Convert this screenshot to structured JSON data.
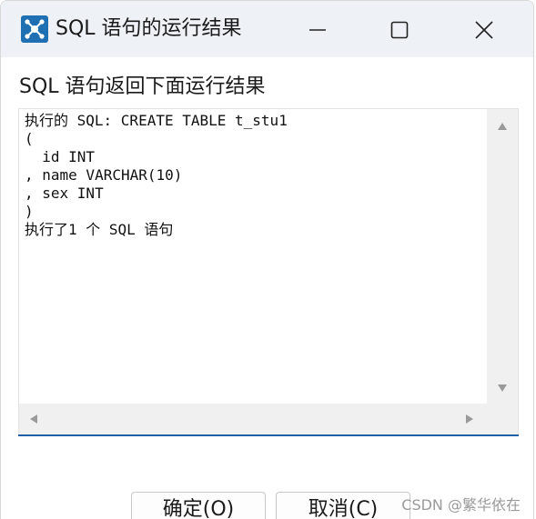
{
  "window": {
    "title": "SQL 语句的运行结果",
    "icon": "network-hub-icon",
    "controls": {
      "minimize": "minimize-icon",
      "maximize": "maximize-icon",
      "close": "close-icon"
    }
  },
  "heading": "SQL 语句返回下面运行结果",
  "result_text": "执行的 SQL: CREATE TABLE t_stu1\n(\n  id INT\n, name VARCHAR(10)\n, sex INT\n)\n执行了1 个 SQL 语句",
  "buttons": {
    "ok": "确定(O)",
    "cancel": "取消(C)"
  },
  "watermark": "CSDN @繁华依在",
  "colors": {
    "titlebar": "#eef2f7",
    "accent": "#1f5fa6",
    "scrollbar": "#f0f0f0"
  }
}
